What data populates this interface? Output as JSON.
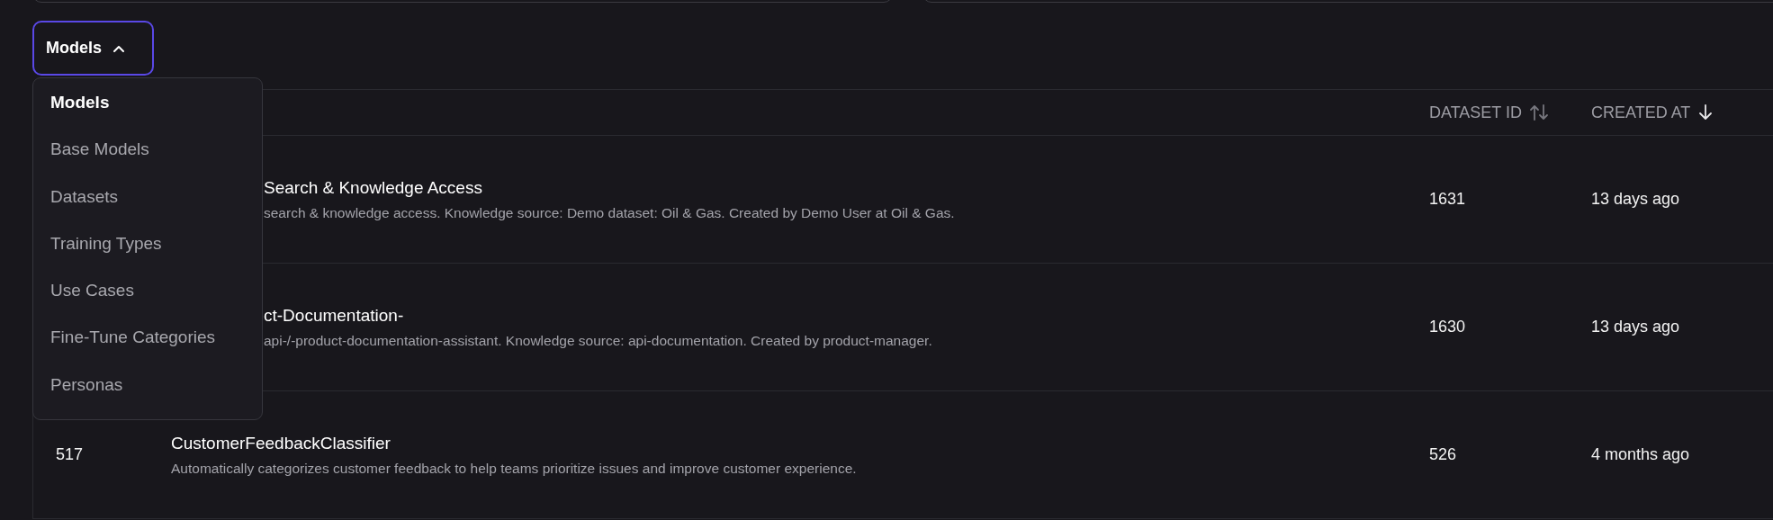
{
  "top_fields": [
    {
      "kind": "field"
    },
    {
      "kind": "field"
    }
  ],
  "view_button": {
    "label": "Models",
    "expanded": true
  },
  "view_menu": {
    "items": [
      {
        "label": "Models",
        "selected": true
      },
      {
        "label": "Base Models",
        "selected": false
      },
      {
        "label": "Datasets",
        "selected": false
      },
      {
        "label": "Training Types",
        "selected": false
      },
      {
        "label": "Use Cases",
        "selected": false
      },
      {
        "label": "Fine-Tune Categories",
        "selected": false
      },
      {
        "label": "Personas",
        "selected": false
      }
    ]
  },
  "table": {
    "columns": [
      {
        "label": "DATASET ID",
        "sorted": false
      },
      {
        "label": "CREATED AT",
        "sorted": true,
        "descending": true
      }
    ],
    "rows": [
      {
        "title": "Search & Knowledge Access",
        "description": "search & knowledge access. Knowledge source: Demo dataset: Oil & Gas. Created by Demo User at Oil & Gas.",
        "dataset_id": "1631",
        "created_at": "13 days ago"
      },
      {
        "title": "ct-Documentation-",
        "description": "api-/-product-documentation-assistant. Knowledge source: api-documentation. Created by product-manager.",
        "dataset_id": "1630",
        "created_at": "13 days ago"
      },
      {
        "id": "517",
        "title": "CustomerFeedbackClassifier",
        "description": "Automatically categorizes customer feedback to help teams prioritize issues and improve customer experience.",
        "dataset_id": "526",
        "created_at": "4 months ago"
      }
    ]
  }
}
